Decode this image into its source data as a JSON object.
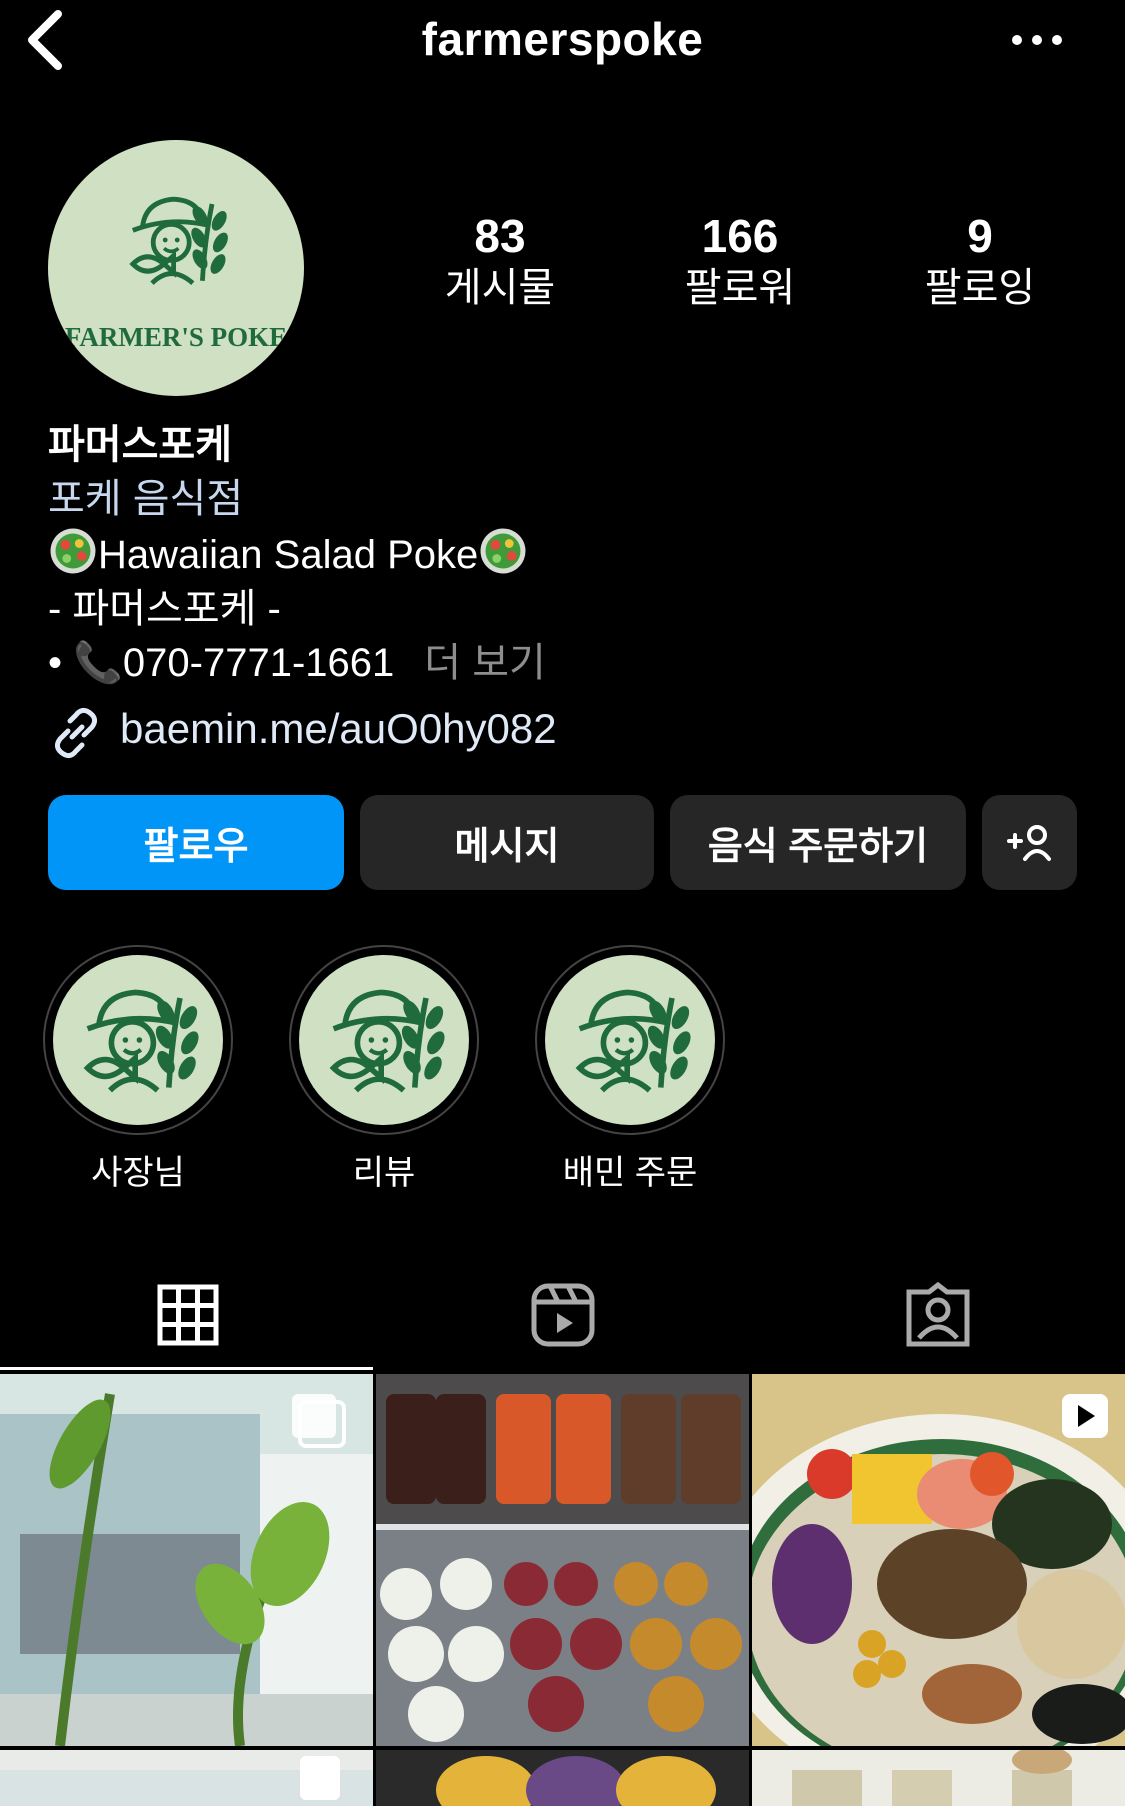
{
  "header": {
    "username": "farmerspoke",
    "back_icon": "chevron-left-icon",
    "more_icon": "ellipsis-icon"
  },
  "stats": {
    "posts_count": "83",
    "posts_label": "게시물",
    "followers_count": "166",
    "followers_label": "팔로워",
    "following_count": "9",
    "following_label": "팔로잉"
  },
  "bio": {
    "name": "파머스포케",
    "category": "포케 음식점",
    "line1": "Hawaiian Salad Poke",
    "line2": "- 파머스포케 -",
    "line3": "• 📞070-7771-1661",
    "more": "더 보기",
    "link": "baemin.me/auO0hy082"
  },
  "avatar_text": "FARMER'S POKE",
  "buttons": {
    "follow": "팔로우",
    "message": "메시지",
    "order": "음식 주문하기"
  },
  "highlights": [
    {
      "label": "사장님"
    },
    {
      "label": "리뷰"
    },
    {
      "label": "배민 주문"
    }
  ],
  "colors": {
    "accent": "#0095f6",
    "button_bg": "#262626",
    "logo_bg": "#cfe0c3",
    "logo_green": "#1f6b3b",
    "link": "#dfe9f7"
  }
}
